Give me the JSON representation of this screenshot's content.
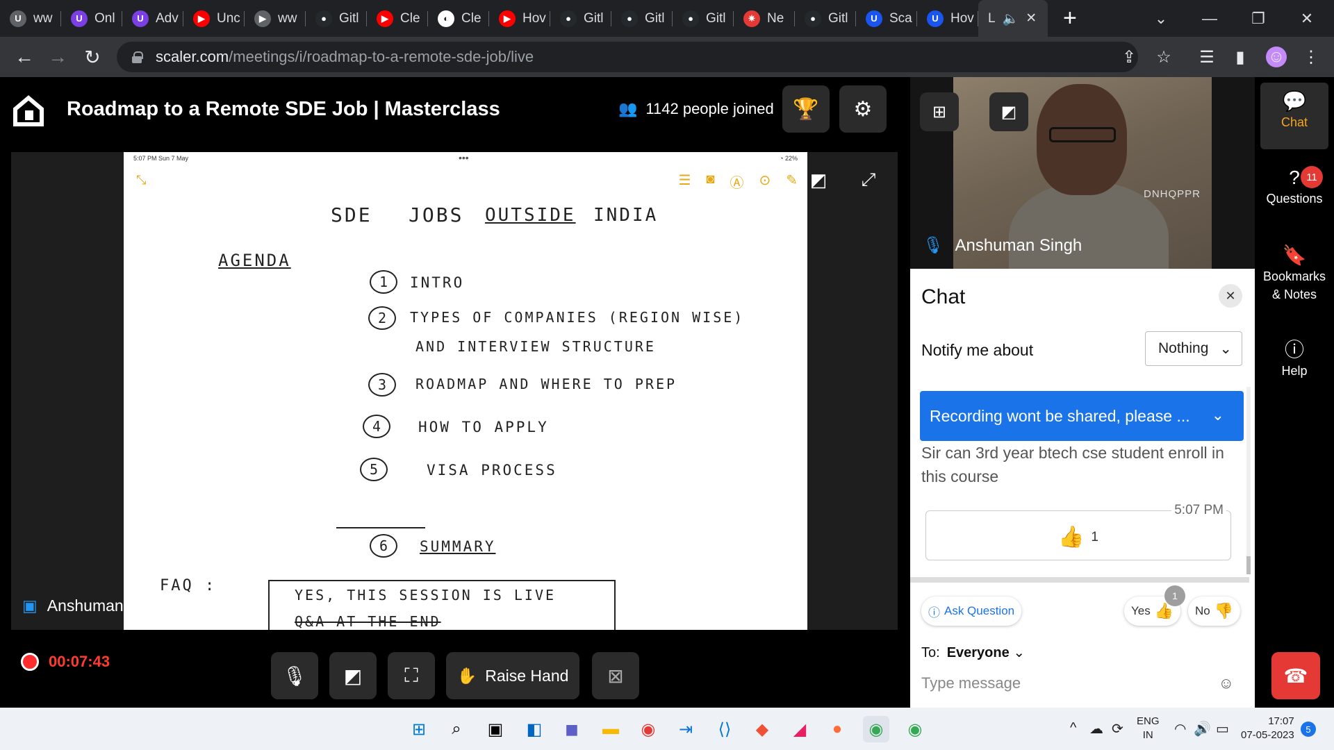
{
  "browser": {
    "tabs": [
      {
        "label": "ww",
        "icon": "scaler-icon",
        "color": "#5f6368"
      },
      {
        "label": "Onl",
        "icon": "scaler-icon",
        "color": "#7b3fe4"
      },
      {
        "label": "Adv",
        "icon": "scaler-icon",
        "color": "#7b3fe4"
      },
      {
        "label": "Unc",
        "icon": "youtube-icon",
        "color": "#ff0000"
      },
      {
        "label": "ww",
        "icon": "video-icon",
        "color": "#5f6368"
      },
      {
        "label": "Gitl",
        "icon": "github-icon",
        "color": "#24292e"
      },
      {
        "label": "Cle",
        "icon": "youtube-icon",
        "color": "#ff0000"
      },
      {
        "label": "Cle",
        "icon": "globe-icon",
        "color": "#ffffff"
      },
      {
        "label": "Hov",
        "icon": "youtube-icon",
        "color": "#ff0000"
      },
      {
        "label": "Gitl",
        "icon": "github-icon",
        "color": "#24292e"
      },
      {
        "label": "Gitl",
        "icon": "github-icon",
        "color": "#24292e"
      },
      {
        "label": "Gitl",
        "icon": "github-icon",
        "color": "#24292e"
      },
      {
        "label": "Ne",
        "icon": "ninja-icon",
        "color": "#e53935"
      },
      {
        "label": "Gitl",
        "icon": "github-icon",
        "color": "#24292e"
      },
      {
        "label": "Sca",
        "icon": "scaler-icon",
        "color": "#1a55f0"
      },
      {
        "label": "Hov",
        "icon": "scaler-icon",
        "color": "#1a55f0"
      }
    ],
    "active_tab": {
      "label": "L",
      "audio_icon": "speaker-icon",
      "close": "✕"
    },
    "new_tab": "+",
    "url_host": "scaler.com",
    "url_path": "/meetings/i/roadmap-to-a-remote-sde-job/live"
  },
  "meeting": {
    "title": "Roadmap to a Remote SDE Job | Masterclass",
    "joined": "1142 people joined",
    "presenter_label": "Anshuman",
    "recording_time": "00:07:43",
    "raise_hand": "Raise Hand"
  },
  "slide": {
    "status_left": "5:07 PM  Sun 7 May",
    "status_right": "22%",
    "title_words": [
      "SDE",
      "JOBS",
      "OUTSIDE",
      "INDIA"
    ],
    "agenda": "AGENDA",
    "items": [
      {
        "num": "1",
        "text": "INTRO"
      },
      {
        "num": "2",
        "text": "TYPES OF COMPANIES (REGION WISE)"
      },
      {
        "num": "",
        "text": "AND INTERVIEW STRUCTURE"
      },
      {
        "num": "3",
        "text": "ROADMAP AND WHERE TO PREP"
      },
      {
        "num": "4",
        "text": "HOW TO APPLY"
      },
      {
        "num": "5",
        "text": "VISA PROCESS"
      },
      {
        "num": "6",
        "text": "SUMMARY"
      }
    ],
    "faq": "FAQ :",
    "faq_box": "YES, THIS SESSION IS LIVE",
    "faq_box2": "Q&A AT THE END"
  },
  "video": {
    "speaker": "Anshuman Singh",
    "tag": "DNHQPPR"
  },
  "chat": {
    "title": "Chat",
    "notify_label": "Notify me about",
    "notify_value": "Nothing",
    "pinned": "Recording wont be shared, please ...",
    "message": "Sir can 3rd year btech cse student enroll in this course",
    "message_time": "5:07 PM",
    "reaction_count": "1",
    "ask_question": "Ask Question",
    "yes": "Yes",
    "yes_count": "1",
    "no": "No",
    "to_label": "To:",
    "to_value": "Everyone",
    "placeholder": "Type message"
  },
  "rail": {
    "chat": "Chat",
    "questions": "Questions",
    "questions_badge": "11",
    "bookmarks": "Bookmarks & Notes",
    "help": "Help"
  },
  "taskbar": {
    "lang1": "ENG",
    "lang2": "IN",
    "time": "17:07",
    "date": "07-05-2023",
    "notifications": "5"
  }
}
